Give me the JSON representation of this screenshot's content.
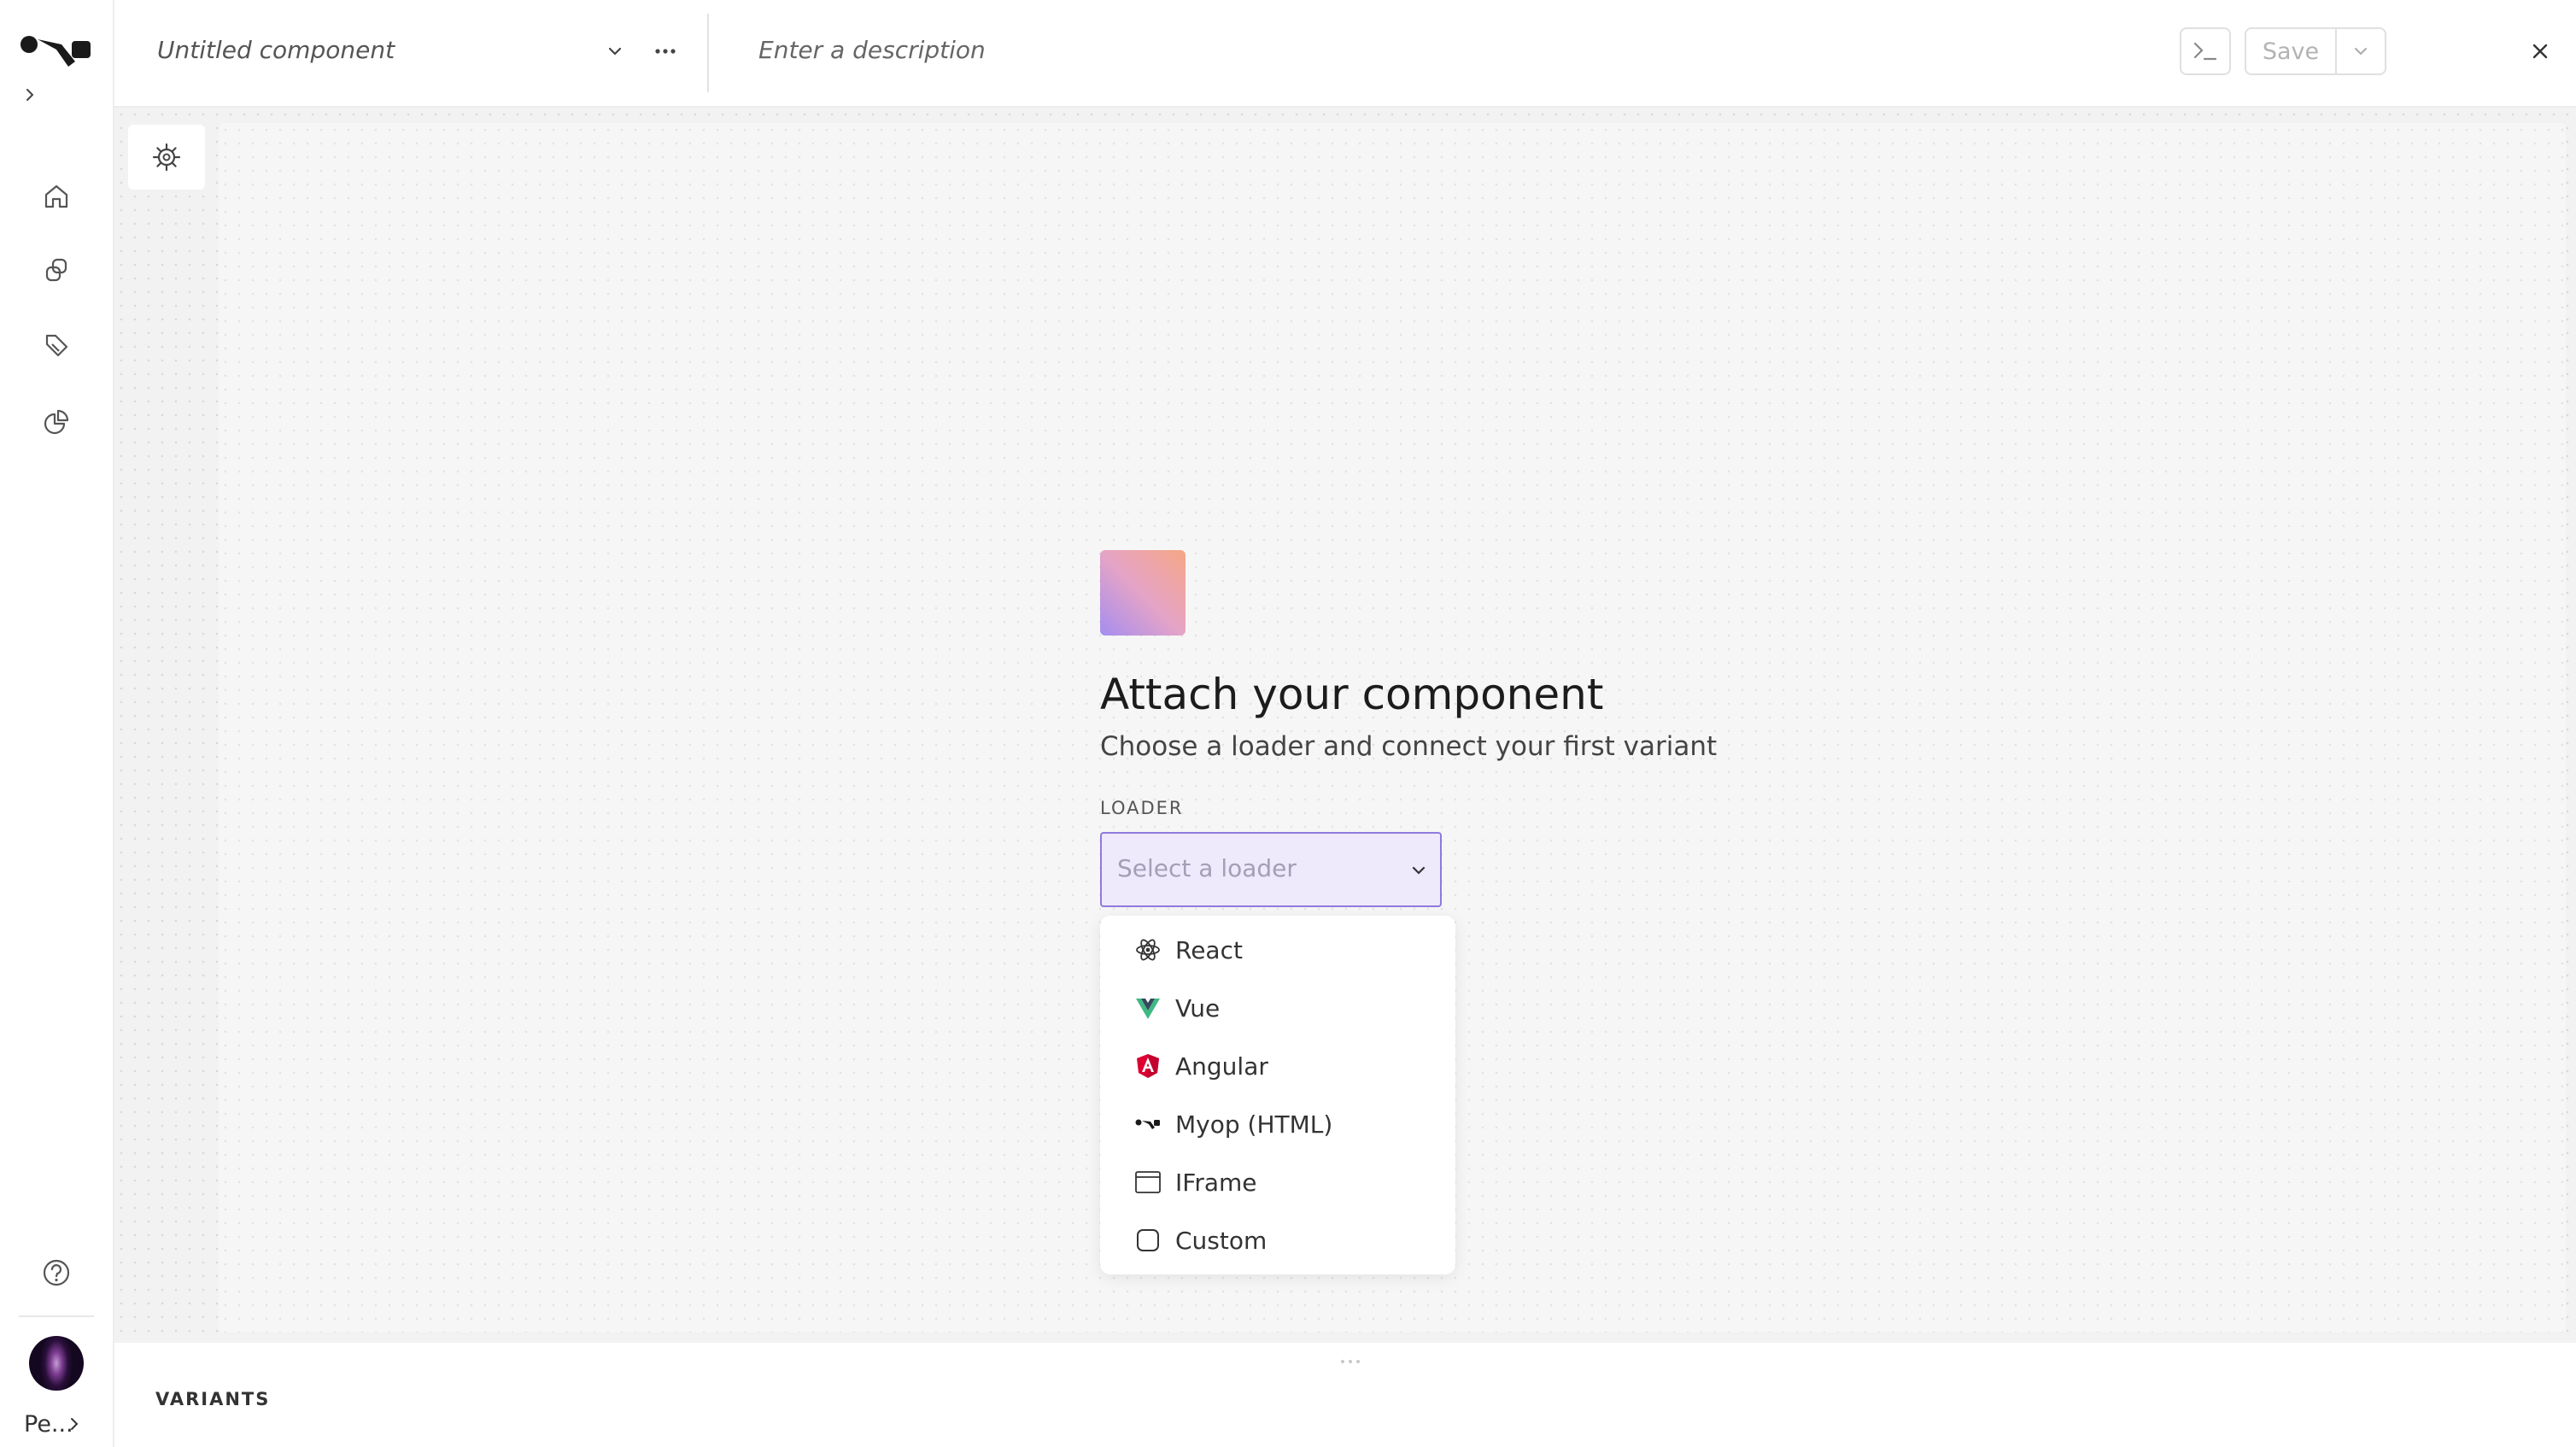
{
  "header": {
    "title": "Untitled component",
    "description_placeholder": "Enter a description",
    "save_label": "Save"
  },
  "sidebar": {
    "nav_items": [
      "home-icon",
      "components-icon",
      "tag-icon",
      "analytics-icon"
    ],
    "help_icon": "help-icon",
    "user_label": "Pe..."
  },
  "main": {
    "title": "Attach your component",
    "subtitle": "Choose a loader and connect your first variant",
    "loader_label": "LOADER",
    "loader_placeholder": "Select a loader",
    "loader_options": [
      {
        "label": "React",
        "icon": "react-icon"
      },
      {
        "label": "Vue",
        "icon": "vue-icon"
      },
      {
        "label": "Angular",
        "icon": "angular-icon"
      },
      {
        "label": "Myop (HTML)",
        "icon": "myop-icon"
      },
      {
        "label": "IFrame",
        "icon": "iframe-icon"
      },
      {
        "label": "Custom",
        "icon": "custom-icon"
      }
    ]
  },
  "variants": {
    "title": "VARIANTS"
  },
  "colors": {
    "accent_border": "#8e7adf",
    "accent_fill": "#efe9fc",
    "angular_red": "#dd0031",
    "vue_green": "#41b883",
    "vue_dark": "#35495e"
  }
}
